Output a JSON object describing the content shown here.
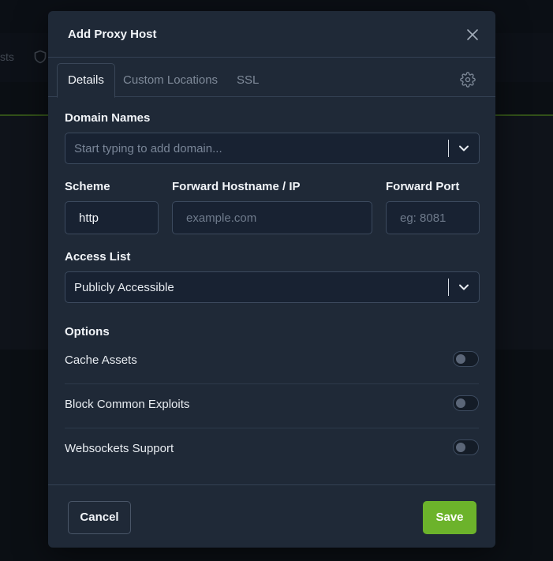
{
  "background": {
    "nav_partial_text": "sts"
  },
  "modal": {
    "title": "Add Proxy Host",
    "tabs": [
      {
        "label": "Details",
        "active": true
      },
      {
        "label": "Custom Locations",
        "active": false
      },
      {
        "label": "SSL",
        "active": false
      }
    ],
    "fields": {
      "domain_names": {
        "label": "Domain Names",
        "placeholder": "Start typing to add domain..."
      },
      "scheme": {
        "label": "Scheme",
        "value": "http"
      },
      "forward_hostname": {
        "label": "Forward Hostname / IP",
        "placeholder": "example.com"
      },
      "forward_port": {
        "label": "Forward Port",
        "placeholder": "eg: 8081"
      },
      "access_list": {
        "label": "Access List",
        "value": "Publicly Accessible"
      }
    },
    "options": {
      "heading": "Options",
      "items": [
        {
          "label": "Cache Assets",
          "enabled": false
        },
        {
          "label": "Block Common Exploits",
          "enabled": false
        },
        {
          "label": "Websockets Support",
          "enabled": false
        }
      ]
    },
    "footer": {
      "cancel_label": "Cancel",
      "save_label": "Save"
    }
  },
  "colors": {
    "accent": "#6cb32b",
    "modal_bg": "#1f2937",
    "input_bg": "#182232"
  },
  "icons": {
    "close": "close-icon",
    "settings": "gear-icon",
    "chevron": "chevron-down-icon",
    "shield": "shield-icon"
  }
}
